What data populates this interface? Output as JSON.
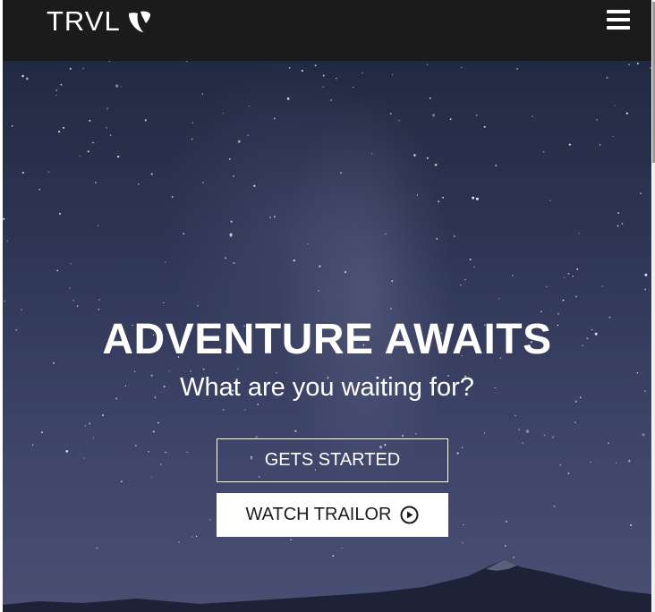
{
  "navbar": {
    "brand_text": "TRVL",
    "logo_icon": "typo3-logo-icon",
    "menu_icon": "hamburger-menu-icon",
    "background": "#1c1b1b"
  },
  "hero": {
    "title": "ADVENTURE AWAITS",
    "subtitle": "What are you waiting for?",
    "primary_button_label": "GETS STARTED",
    "secondary_button_label": "WATCH TRAILOR",
    "secondary_button_icon": "play-circle-icon"
  },
  "colors": {
    "text": "#ffffff",
    "button_text_dark": "#1c1c1c"
  }
}
